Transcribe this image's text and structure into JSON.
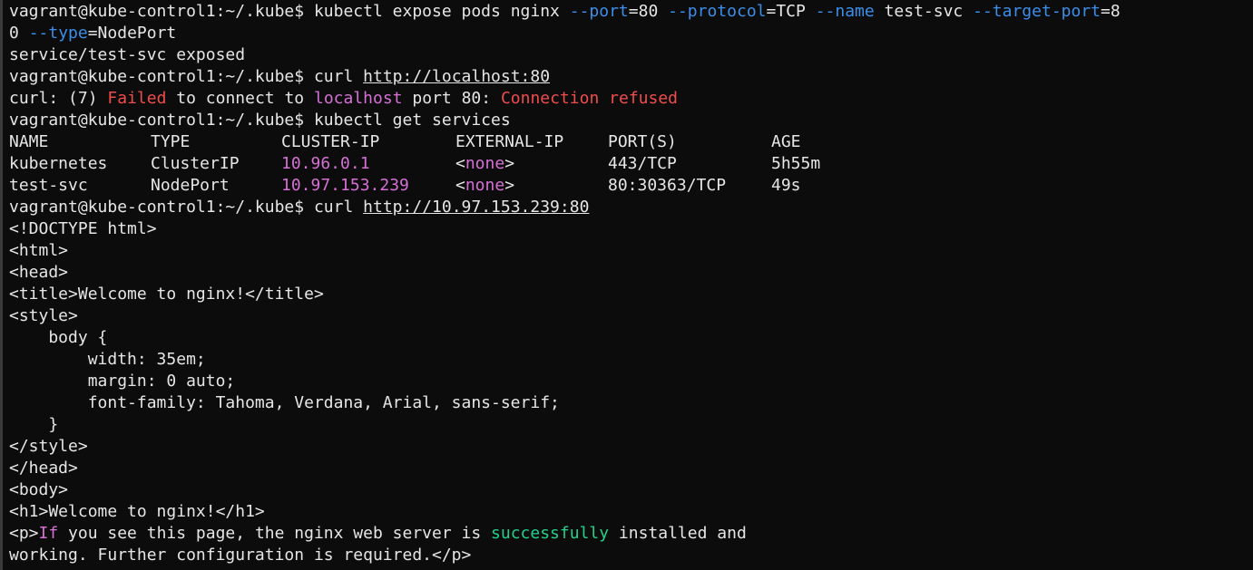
{
  "colors": {
    "background": "#0c0c0c",
    "text": "#e6e6e6",
    "option_flag": "#3b8eea",
    "error": "#f14c4c",
    "highlight": "#d670d6",
    "success": "#23d18b"
  },
  "prompt": "vagrant@kube-control1:~/.kube$",
  "expose_cmd": {
    "base": "kubectl expose pods nginx",
    "port_flag": "--port",
    "port_value": "=80",
    "protocol_flag": "--protocol",
    "protocol_value": "=TCP",
    "name_flag": "--name",
    "name_value": "test-svc",
    "target_flag": "--target-port",
    "target_value": "=8",
    "wrap_value": "0",
    "type_flag": "--type",
    "type_value": "=NodePort"
  },
  "expose_output": "service/test-svc exposed",
  "curl1": {
    "cmd": "curl",
    "url": "http://localhost:80"
  },
  "curl1_error": {
    "prefix": "curl: (7)",
    "failed": "Failed",
    "mid": "to connect to",
    "host": "localhost",
    "port": "port 80:",
    "refused": "Connection refused"
  },
  "get_cmd": "kubectl get services",
  "services": {
    "headers": [
      "NAME",
      "TYPE",
      "CLUSTER-IP",
      "EXTERNAL-IP",
      "PORT(S)",
      "AGE"
    ],
    "rows": [
      {
        "name": "kubernetes",
        "type": "ClusterIP",
        "cluster_ip": "10.96.0.1",
        "external_ip": "<none>",
        "ports": "443/TCP",
        "age": "5h55m"
      },
      {
        "name": "test-svc",
        "type": "NodePort",
        "cluster_ip": "10.97.153.239",
        "external_ip": "<none>",
        "ports": "80:30363/TCP",
        "age": "49s"
      }
    ]
  },
  "curl2": {
    "cmd": "curl",
    "url": "http://10.97.153.239:80"
  },
  "html_output": {
    "l1": "<!DOCTYPE html>",
    "l2": "<html>",
    "l3": "<head>",
    "l4": "<title>Welcome to nginx!</title>",
    "l5": "<style>",
    "l6": "    body {",
    "l7": "        width: 35em;",
    "l8": "        margin: 0 auto;",
    "l9": "        font-family: Tahoma, Verdana, Arial, sans-serif;",
    "l10": "    }",
    "l11": "</style>",
    "l12": "</head>",
    "l13": "<body>",
    "l14": "<h1>Welcome to nginx!</h1>",
    "l15_open": "<p>",
    "l15_if": "If",
    "l15_mid": " you see this page, the nginx web server is ",
    "l15_success": "successfully",
    "l15_end": " installed and",
    "l16": "working. Further configuration is required.</p>"
  }
}
